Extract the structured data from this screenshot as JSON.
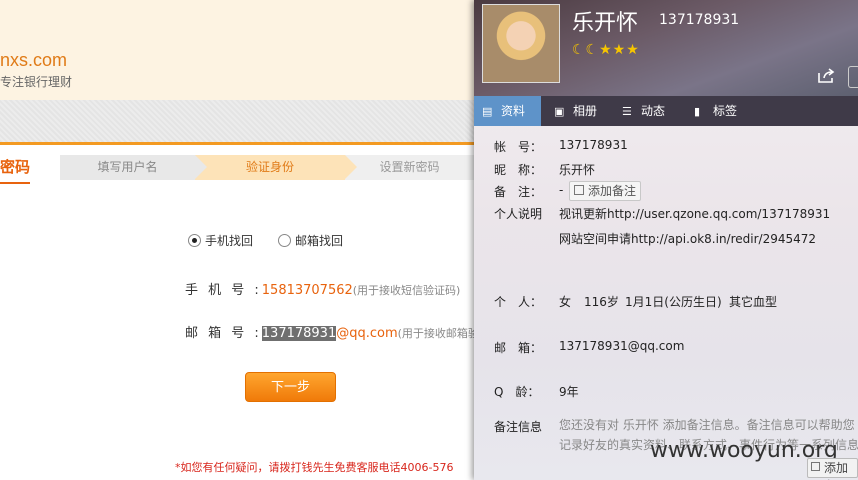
{
  "site": {
    "domain": "nxs.com",
    "slogan": "专注银行理财"
  },
  "reset": {
    "tab_title": "密码",
    "steps": [
      "填写用户名",
      "验证身份",
      "设置新密码"
    ],
    "radio_phone": "手机找回",
    "radio_email": "邮箱找回",
    "phone_label": "手 机 号 :",
    "phone_value": "15813707562",
    "phone_note": "(用于接收短信验证码)",
    "email_label": "邮 箱 号 :",
    "email_selected": "137178931",
    "email_domain": "@qq.com",
    "email_note": "(用于接收邮箱验证",
    "next_button": "下一步",
    "footer": "*如您有任何疑问，请拨打钱先生免费客服电话4006-576"
  },
  "profile": {
    "nickname": "乐开怀",
    "qq_number": "137178931",
    "level_icons": "☾☾★★★",
    "tabs": [
      {
        "icon": "▤",
        "label": "资料"
      },
      {
        "icon": "▣",
        "label": "相册"
      },
      {
        "icon": "☰",
        "label": "动态"
      },
      {
        "icon": "▮",
        "label": "标签"
      }
    ],
    "account_label": "帐　号：",
    "account_value": "137178931",
    "nick_label": "昵　称：",
    "nick_value": "乐开怀",
    "remark_label": "备　注：",
    "remark_value": "-",
    "add_remark": "添加备注",
    "desc_label": "个人说明",
    "desc_line1": "视讯更新http://user.qzone.qq.com/137178931",
    "desc_line2": "网站空间申请http://api.ok8.in/redir/2945472",
    "person_label": "个　人：",
    "person_gender": "女",
    "person_age": "116岁",
    "person_birthday": "1月1日(公历生日)",
    "person_blood": "其它血型",
    "email_label": "邮　箱：",
    "email_value": "137178931@qq.com",
    "qage_label": "Q　龄：",
    "qage_value": "9年",
    "remark_info_label": "备注信息",
    "remark_info_text": "您还没有对 乐开怀 添加备注信息。备注信息可以帮助您记录好友的真实资料、联系方式、事件行为等一系列信息",
    "add_remark_bottom": "添加备",
    "watermark": "www.wooyun.org"
  }
}
